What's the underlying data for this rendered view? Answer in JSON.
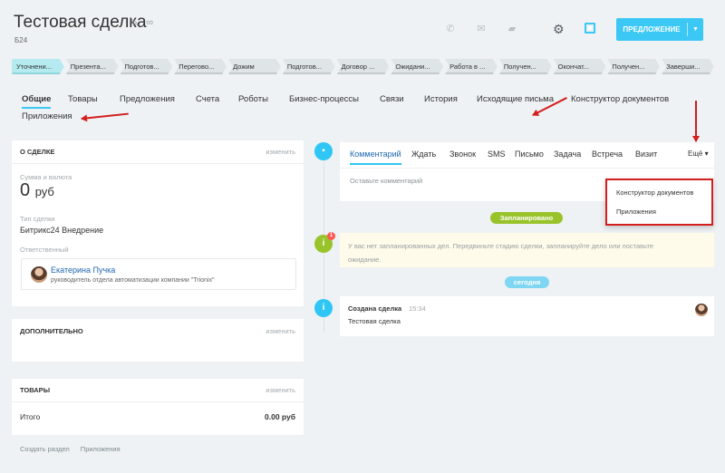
{
  "header": {
    "title": "Тестовая сделка",
    "subtitle": "Б24",
    "edit_icon": "pencil-icon",
    "link_icon": "link-icon",
    "icons": [
      "phone-icon",
      "mail-icon",
      "chat-icon"
    ],
    "primary_button": "ПРЕДЛОЖЕНИЕ"
  },
  "stages": [
    "Уточнени...",
    "Презента...",
    "Подготов...",
    "Перегово...",
    "Дожим",
    "Подготов...",
    "Договор ...",
    "Ожидани...",
    "Работа в ...",
    "Получен...",
    "Окончат...",
    "Получен...",
    "Заверши..."
  ],
  "tabs": [
    "Общие",
    "Товары",
    "Предложения",
    "Счета",
    "Роботы",
    "Бизнес-процессы",
    "Связи",
    "История",
    "Исходящие письма",
    "Конструктор документов",
    "Приложения"
  ],
  "about": {
    "title": "О СДЕЛКЕ",
    "edit": "изменить",
    "amount_label": "Сумма и валюта",
    "amount_value": "0",
    "amount_currency": "руб",
    "type_label": "Тип сделки",
    "type_value": "Битрикс24 Внедрение",
    "responsible_label": "Ответственный",
    "responsible_name": "Екатерина Пучка",
    "responsible_position": "руководитель отдела автоматизации компании \"Trionix\""
  },
  "additional": {
    "title": "ДОПОЛНИТЕЛЬНО",
    "edit": "изменить"
  },
  "products": {
    "title": "ТОВАРЫ",
    "edit": "изменить",
    "total_label": "Итого",
    "total_value": "0.00 руб"
  },
  "bottom_links": [
    "Создать раздел",
    "Приложения"
  ],
  "editor": {
    "tabs": [
      "Комментарий",
      "Ждать",
      "Звонок",
      "SMS",
      "Письмо",
      "Задача",
      "Встреча",
      "Визит",
      "Ещё"
    ],
    "placeholder": "Оставьте комментарий"
  },
  "dropdown": [
    "Конструктор документов",
    "Приложения"
  ],
  "planned_label": "Запланировано",
  "notice_text": "У вас нет запланированных дел. Передвиньте стадию сделки, запланируйте дело или поставьте ожидание.",
  "notice_badge": "1",
  "today_label": "сегодня",
  "deal_created": {
    "title": "Создана сделка",
    "time": "15:34",
    "name": "Тестовая сделка"
  },
  "colors": {
    "accent": "#3bc8f5",
    "link": "#2067b0",
    "annotation": "#d41e1e",
    "planned": "#99c32b"
  }
}
